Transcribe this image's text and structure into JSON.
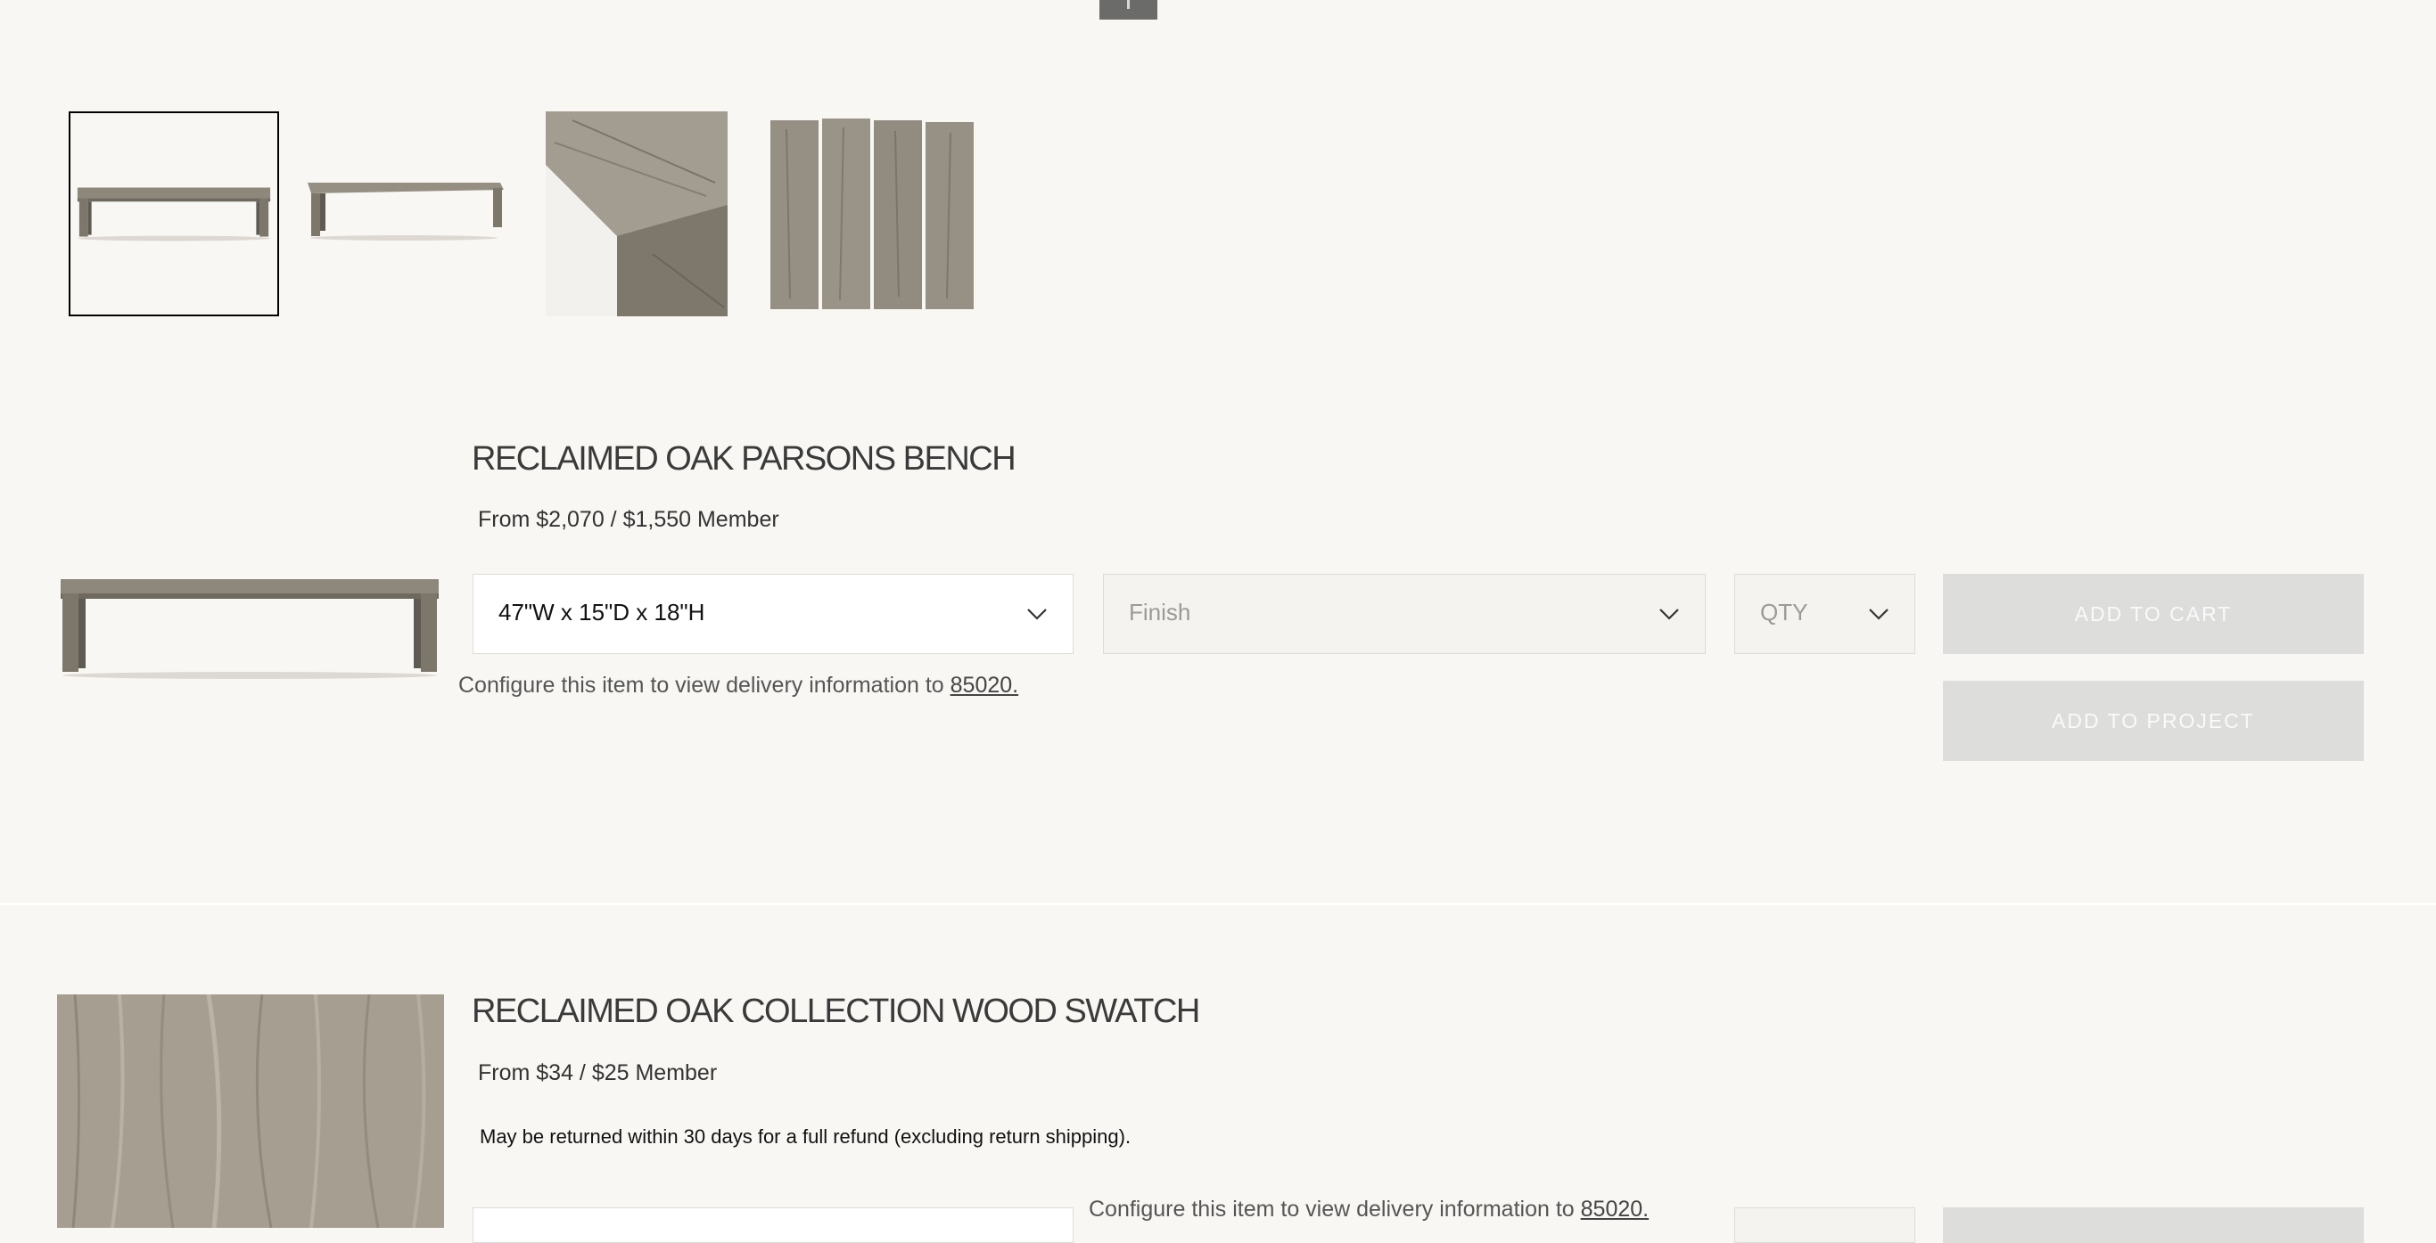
{
  "thumbnails": [
    {
      "name": "bench-front-view"
    },
    {
      "name": "bench-angle-view"
    },
    {
      "name": "wood-corner-detail"
    },
    {
      "name": "wood-planks-swatch"
    }
  ],
  "product_1": {
    "title": "RECLAIMED OAK PARSONS BENCH",
    "price": "From $2,070 / $1,550 Member",
    "size_value": "47\"W x 15\"D x 18\"H",
    "finish_placeholder": "Finish",
    "qty_placeholder": "QTY",
    "add_to_cart": "ADD TO CART",
    "add_to_project": "ADD TO PROJECT",
    "delivery_text": "Configure this item to view delivery information to",
    "zip": "85020."
  },
  "product_2": {
    "title": "RECLAIMED OAK COLLECTION WOOD SWATCH",
    "price": "From $34 / $25 Member",
    "return_note": "May be returned within 30 days for a full refund (excluding return shipping).",
    "delivery_text": "Configure this item to view delivery information to",
    "zip": "85020."
  },
  "colors": {
    "background": "#f8f7f4",
    "button_disabled": "#dddddc",
    "wood": "#8a8274"
  }
}
